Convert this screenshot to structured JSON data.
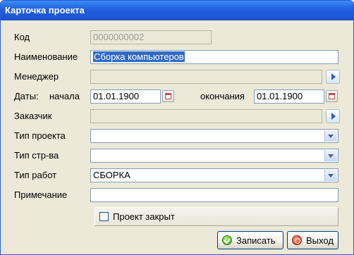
{
  "window": {
    "title": "Карточка проекта"
  },
  "form": {
    "code": {
      "label": "Код",
      "value": "0000000002"
    },
    "name": {
      "label": "Наименование",
      "value": "Сборка компьютеров"
    },
    "manager": {
      "label": "Менеджер",
      "value": ""
    },
    "dates": {
      "label": "Даты:",
      "start_label": "начала",
      "start_value": "01.01.1900",
      "end_label": "окончания",
      "end_value": "01.01.1900"
    },
    "customer": {
      "label": "Заказчик",
      "value": ""
    },
    "project_type": {
      "label": "Тип проекта",
      "value": ""
    },
    "construction_type": {
      "label": "Тип стр-ва",
      "value": ""
    },
    "work_type": {
      "label": "Тип работ",
      "value": "СБОРКА"
    },
    "note": {
      "label": "Примечание",
      "value": ""
    },
    "closed": {
      "label": "Проект закрыт",
      "checked": false
    }
  },
  "buttons": {
    "save": "Записать",
    "exit": "Выход"
  },
  "icons": {
    "lookup": "arrow-right-icon",
    "calendar": "calendar-icon",
    "save": "checkmark-icon",
    "exit": "exit-icon",
    "dropdown": "chevron-down-icon"
  }
}
